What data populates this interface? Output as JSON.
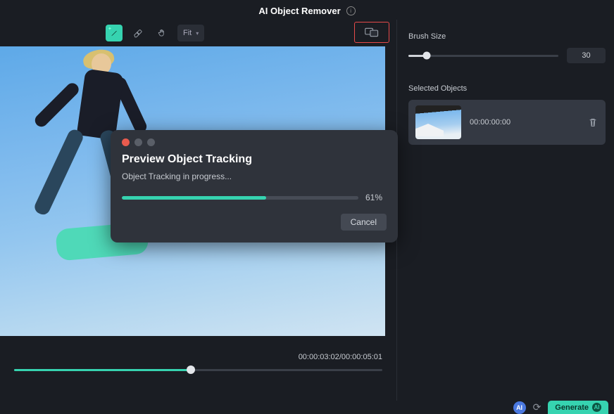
{
  "header": {
    "title": "AI Object Remover"
  },
  "toolbar": {
    "fit_label": "Fit"
  },
  "timeline": {
    "current": "00:00:03:02",
    "total": "00:00:05:01"
  },
  "sidebar": {
    "brush_label": "Brush Size",
    "brush_value": "30",
    "selected_label": "Selected Objects",
    "objects": [
      {
        "time": "00:00:00:00"
      }
    ]
  },
  "modal": {
    "title": "Preview Object Tracking",
    "status": "Object Tracking in progress...",
    "percent_text": "61%",
    "cancel": "Cancel"
  },
  "footer": {
    "generate": "Generate"
  },
  "colors": {
    "accent": "#36d3b0",
    "highlight": "#e64a4a"
  }
}
